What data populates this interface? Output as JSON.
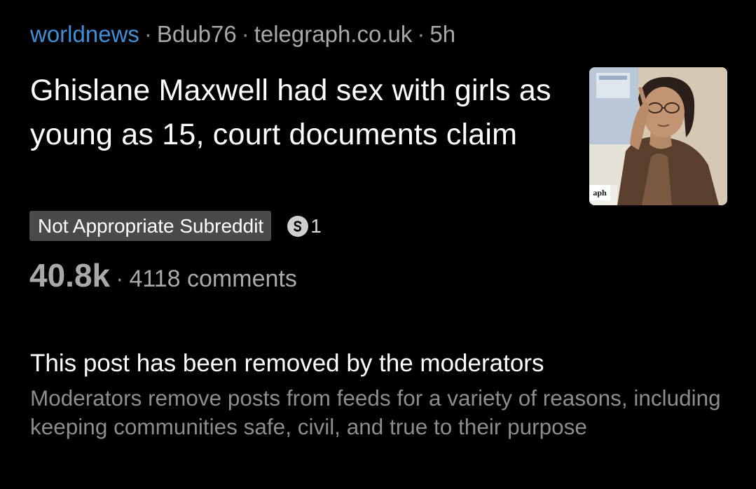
{
  "post": {
    "subreddit": "worldnews",
    "author": "Bdub76",
    "domain": "telegraph.co.uk",
    "age": "5h",
    "title": "Ghislane Maxwell had sex with girls as young as 15, court documents claim",
    "thumbnail": {
      "icon": "sketch-portrait-thumbnail",
      "caption": "aph"
    },
    "flair": "Not Appropriate Subreddit",
    "award": {
      "icon": "silver-award-icon",
      "count": "1"
    },
    "score": "40.8k",
    "comments": "4118 comments"
  },
  "removed_notice": {
    "title": "This post has been removed by the moderators",
    "description": "Moderators remove posts from feeds for a variety of reasons, including keeping communities safe, civil, and true to their purpose"
  },
  "colors": {
    "background": "#000000",
    "subreddit_link": "#3f8fd6",
    "flair_background": "#4a4a4a",
    "muted_text": "#8d8d8d"
  }
}
